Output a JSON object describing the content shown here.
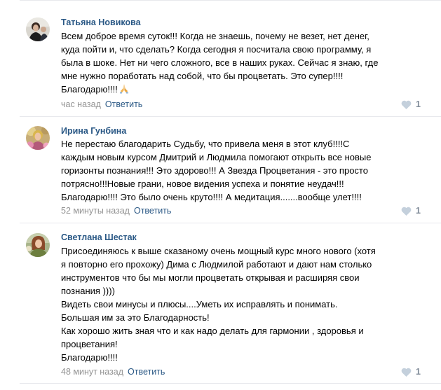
{
  "comments": [
    {
      "author": "Татьяна Новикова",
      "lines": [
        "Всем доброе время суток!!! Когда не знаешь, почему не везет, нет денег,",
        "куда пойти и, что сделать? Когда сегодня я посчитала свою программу, я",
        "была в шоке. Нет ни чего сложного, все в наших руках. Сейчас я знаю, где",
        "мне нужно поработать над собой, что бы процветать. Это супер!!!!",
        "Благодарю!!!!"
      ],
      "emoji": "praying-hands-emoji",
      "time": "час назад",
      "reply": "Ответить",
      "likes": "1"
    },
    {
      "author": "Ирина Гунбина",
      "lines": [
        "Не перестаю благодарить Судьбу, что привела меня в этот клуб!!!!С",
        "каждым новым курсом Дмитрий и Людмила помогают открыть все новые",
        "горизонты познания!!! Это здорово!!! А Звезда Процветания - это просто",
        "потрясно!!!Новые грани, новое видения успеха и понятие неудач!!!",
        "Благодарю!!!! Это было очень круто!!!! А медитация.......вообще улет!!!!"
      ],
      "time": "52 минуты назад",
      "reply": "Ответить",
      "likes": "1"
    },
    {
      "author": "Светлана Шестак",
      "lines": [
        "Присоединяюсь к выше сказаному очень мощный курс много нового (хотя",
        "я повторно его прохожу) Дима с Людмилой работают и дают нам столько",
        "инструментов что бы мы могли процветать открывая и расширяя свои",
        "познания ))))",
        "Видеть свои минусы и плюсы....Уметь их исправлять и понимать.",
        "Большая им за это Благодарность!",
        "Как хорошо жить зная что и как надо делать для гармонии , здоровья и",
        "процветания!",
        "Благодарю!!!!"
      ],
      "time": "48 минут назад",
      "reply": "Ответить",
      "likes": "1"
    }
  ],
  "colors": {
    "author": "#2a5885",
    "link": "#2a5885",
    "meta": "#939393",
    "likes": "#818c99",
    "divider": "#e7e8ec"
  }
}
